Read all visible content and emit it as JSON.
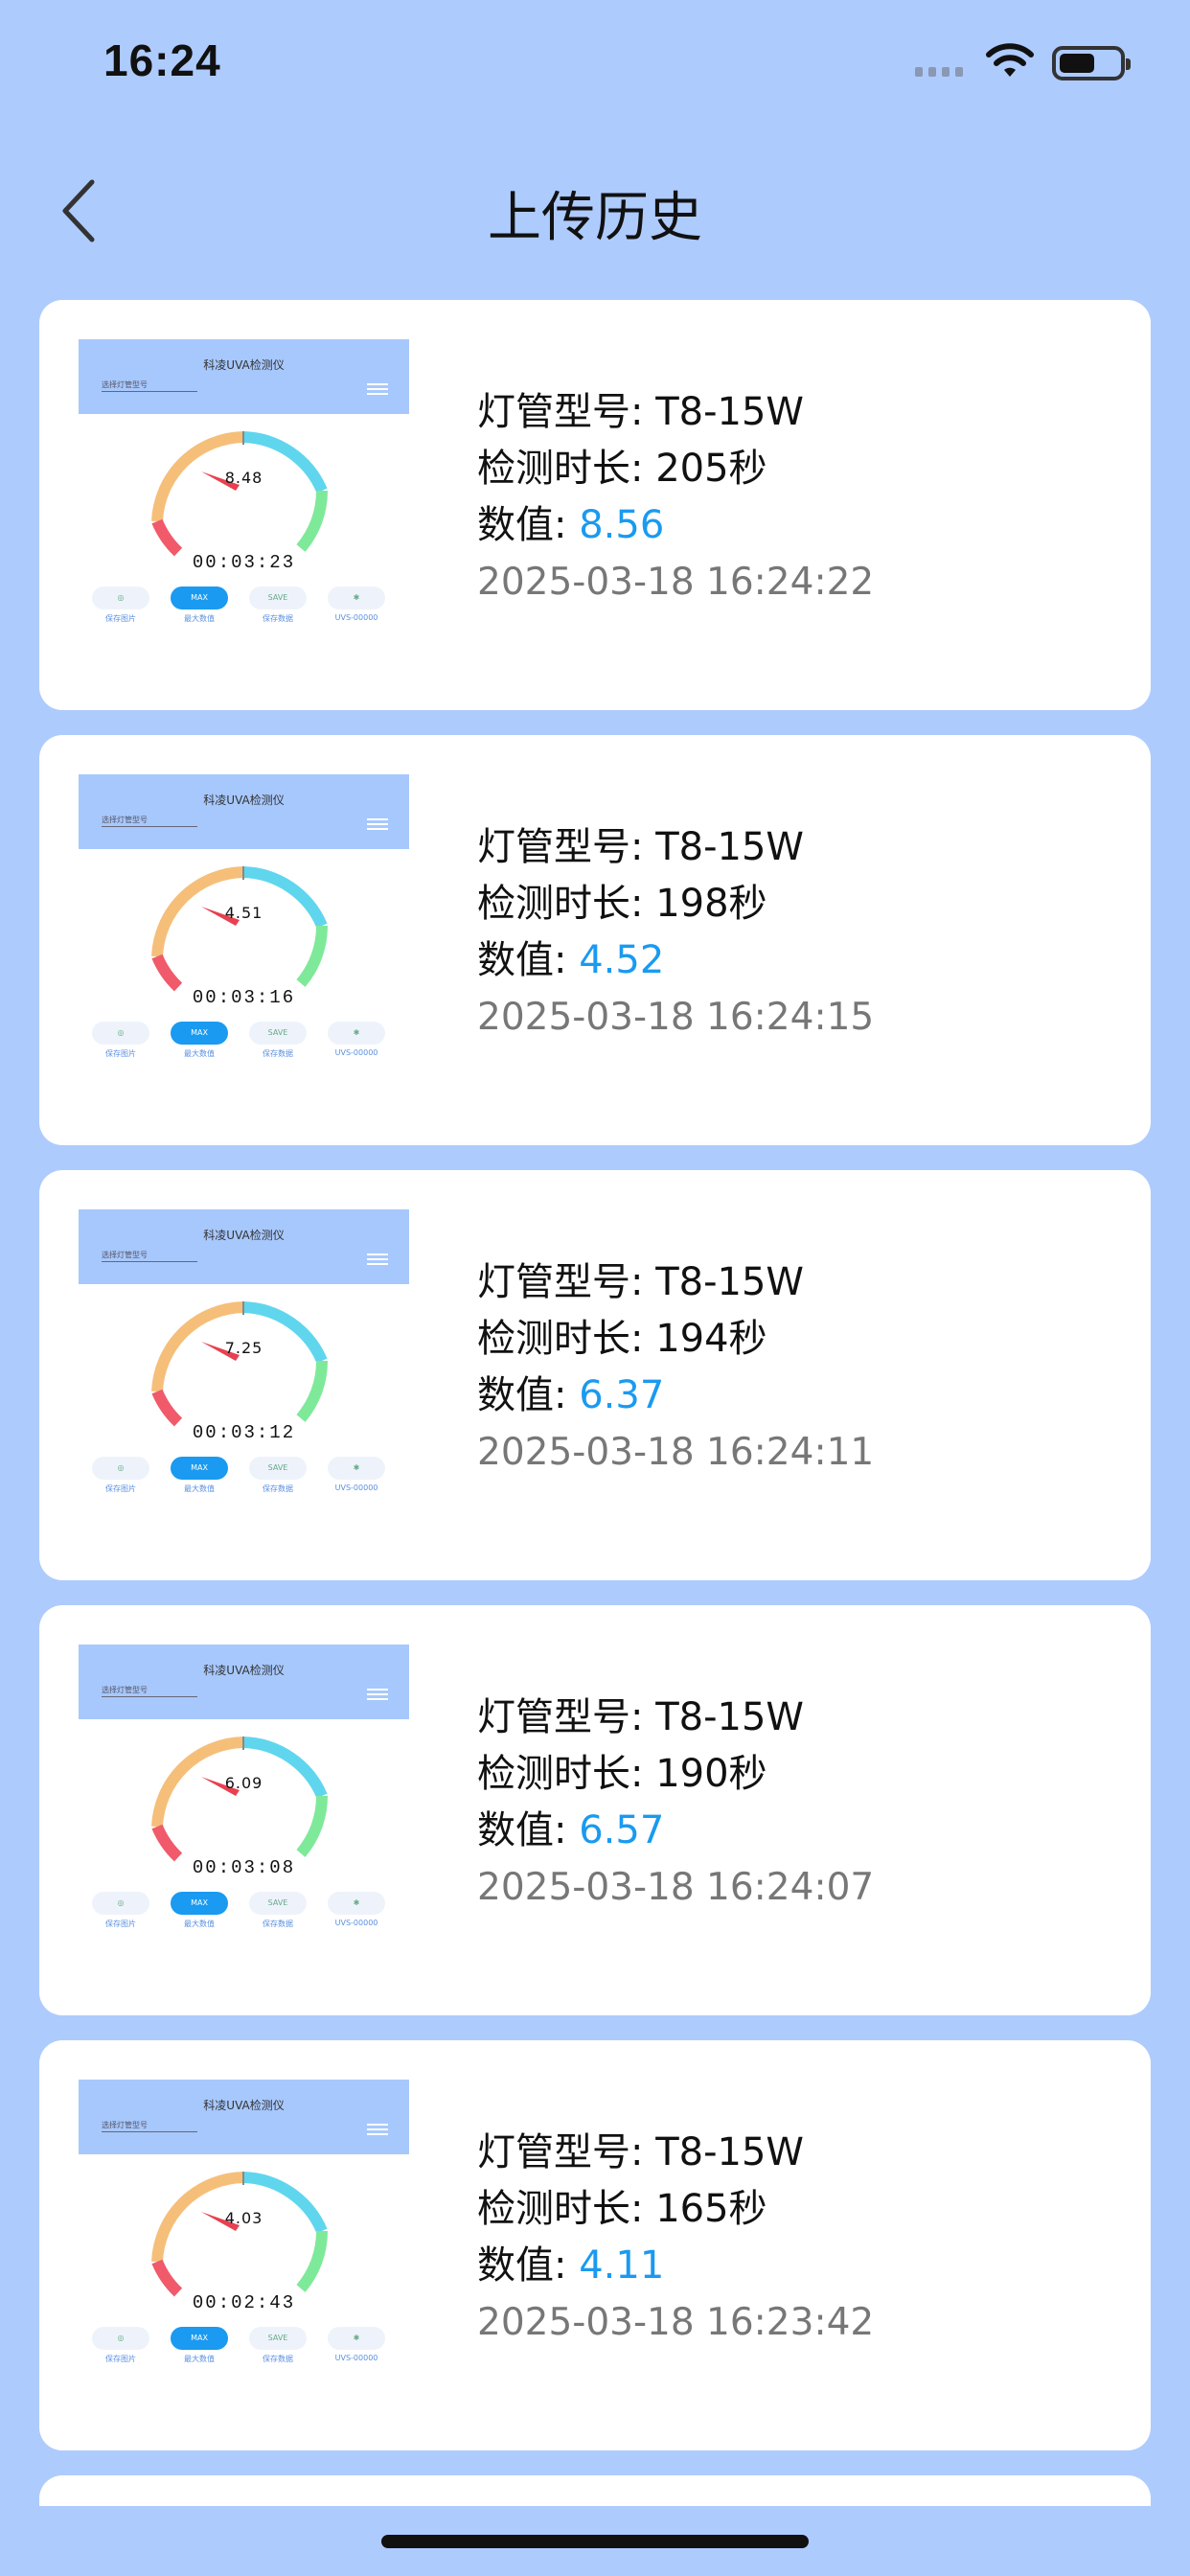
{
  "status_bar": {
    "time": "16:24"
  },
  "nav": {
    "title": "上传历史"
  },
  "labels": {
    "model": "灯管型号: ",
    "duration": "检测时长: ",
    "value": "数值: "
  },
  "thumbnail": {
    "app_title": "科凌UVA检测仪",
    "select_label": "选择灯管型号",
    "buttons": [
      "MAX",
      "SAVE"
    ],
    "button_labels": [
      "保存图片",
      "最大数值",
      "保存数据",
      "UVS-00000"
    ]
  },
  "records": [
    {
      "model": "T8-15W",
      "duration": "205秒",
      "value": "8.56",
      "date": "2025-03-18 16:24:22",
      "gauge": "8.48",
      "elapsed": "00:03:23"
    },
    {
      "model": "T8-15W",
      "duration": "198秒",
      "value": "4.52",
      "date": "2025-03-18 16:24:15",
      "gauge": "4.51",
      "elapsed": "00:03:16"
    },
    {
      "model": "T8-15W",
      "duration": "194秒",
      "value": "6.37",
      "date": "2025-03-18 16:24:11",
      "gauge": "7.25",
      "elapsed": "00:03:12"
    },
    {
      "model": "T8-15W",
      "duration": "190秒",
      "value": "6.57",
      "date": "2025-03-18 16:24:07",
      "gauge": "6.09",
      "elapsed": "00:03:08"
    },
    {
      "model": "T8-15W",
      "duration": "165秒",
      "value": "4.11",
      "date": "2025-03-18 16:23:42",
      "gauge": "4.03",
      "elapsed": "00:02:43"
    }
  ],
  "colors": {
    "background": "#aecbfd",
    "accent": "#1a9af0",
    "card": "#ffffff"
  }
}
